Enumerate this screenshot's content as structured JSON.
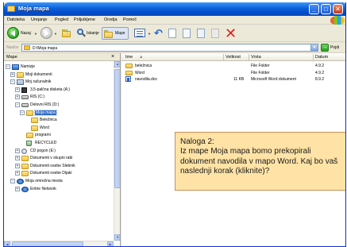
{
  "window": {
    "title": "Moja mapa",
    "buttons": {
      "minimize": "_",
      "maximize": "□",
      "close": "✕"
    }
  },
  "menu": [
    "Datoteka",
    "Urejanje",
    "Pogled",
    "Priljubljene",
    "Orodja",
    "Pomoč"
  ],
  "toolbar": {
    "back_label": "Nazaj",
    "search_label": "Iskanje",
    "folders_label": "Mape",
    "icons": [
      "back-icon",
      "forward-icon",
      "up-folder-icon",
      "search-icon",
      "folders-icon",
      "views-icon",
      "undo-icon",
      "copy-to-icon",
      "paste-icon",
      "move-to-icon",
      "delete-icon"
    ]
  },
  "address": {
    "label": "Naslov",
    "value": "D:\\Moja mapa",
    "go_label": "Pojdi"
  },
  "folders_pane": {
    "title": "Mape",
    "close": "×",
    "tree": [
      {
        "label": "Namizje",
        "icon": "desktop-icon",
        "expander": "−",
        "level": 0
      },
      {
        "label": "Moji dokumenti",
        "icon": "folder-icon",
        "expander": "+",
        "level": 1
      },
      {
        "label": "Moj računalnik",
        "icon": "computer-icon",
        "expander": "−",
        "level": 1
      },
      {
        "label": "3,5-palčna disketa (A:)",
        "icon": "floppy-icon",
        "expander": "+",
        "level": 2
      },
      {
        "label": "RIS (C:)",
        "icon": "drive-icon",
        "expander": "+",
        "level": 2
      },
      {
        "label": "Delovni RIS (D:)",
        "icon": "drive-icon",
        "expander": "−",
        "level": 2
      },
      {
        "label": "Moja mapa",
        "icon": "folder-icon",
        "expander": "−",
        "level": 3,
        "selected": true
      },
      {
        "label": "Beležnica",
        "icon": "folder-icon",
        "expander": "",
        "level": 4
      },
      {
        "label": "Word",
        "icon": "folder-icon",
        "expander": "",
        "level": 4
      },
      {
        "label": "programi",
        "icon": "folder-icon",
        "expander": "",
        "level": 3
      },
      {
        "label": "RECYCLED",
        "icon": "recycle-bin-icon",
        "expander": "",
        "level": 3
      },
      {
        "label": "CD pogon (E:)",
        "icon": "cd-drive-icon",
        "expander": "+",
        "level": 2
      },
      {
        "label": "Dokumenti v skupni rabi",
        "icon": "folder-icon",
        "expander": "+",
        "level": 2
      },
      {
        "label": "Dokumenti osebe Slebnik",
        "icon": "folder-icon",
        "expander": "+",
        "level": 2
      },
      {
        "label": "Dokumenti osebe Dijaki",
        "icon": "folder-icon",
        "expander": "+",
        "level": 2
      },
      {
        "label": "Moja omrežna mesta",
        "icon": "network-icon",
        "expander": "−",
        "level": 1
      },
      {
        "label": "Entire Network",
        "icon": "network-icon",
        "expander": "+",
        "level": 2
      }
    ]
  },
  "file_list": {
    "columns": [
      "Ime",
      "Velikost",
      "Vrsta",
      "Datum"
    ],
    "sort_indicator": "▲",
    "rows": [
      {
        "name": "beležnica",
        "size": "",
        "type": "File Folder",
        "date": "4.9.2",
        "icon": "folder-icon"
      },
      {
        "name": "Word",
        "size": "",
        "type": "File Folder",
        "date": "4.9.2",
        "icon": "folder-icon"
      },
      {
        "name": "navodila.doc",
        "size": "11 KB",
        "type": "Microsoft Word dokument",
        "date": "8.9.2",
        "icon": "word-document-icon"
      }
    ]
  },
  "task": {
    "title": "Naloga 2:",
    "text": "Iz mape Moja mapa bomo prekopirali dokument navodila v mapo Word. Kaj bo vaš naslednji korak (kliknite)?"
  }
}
